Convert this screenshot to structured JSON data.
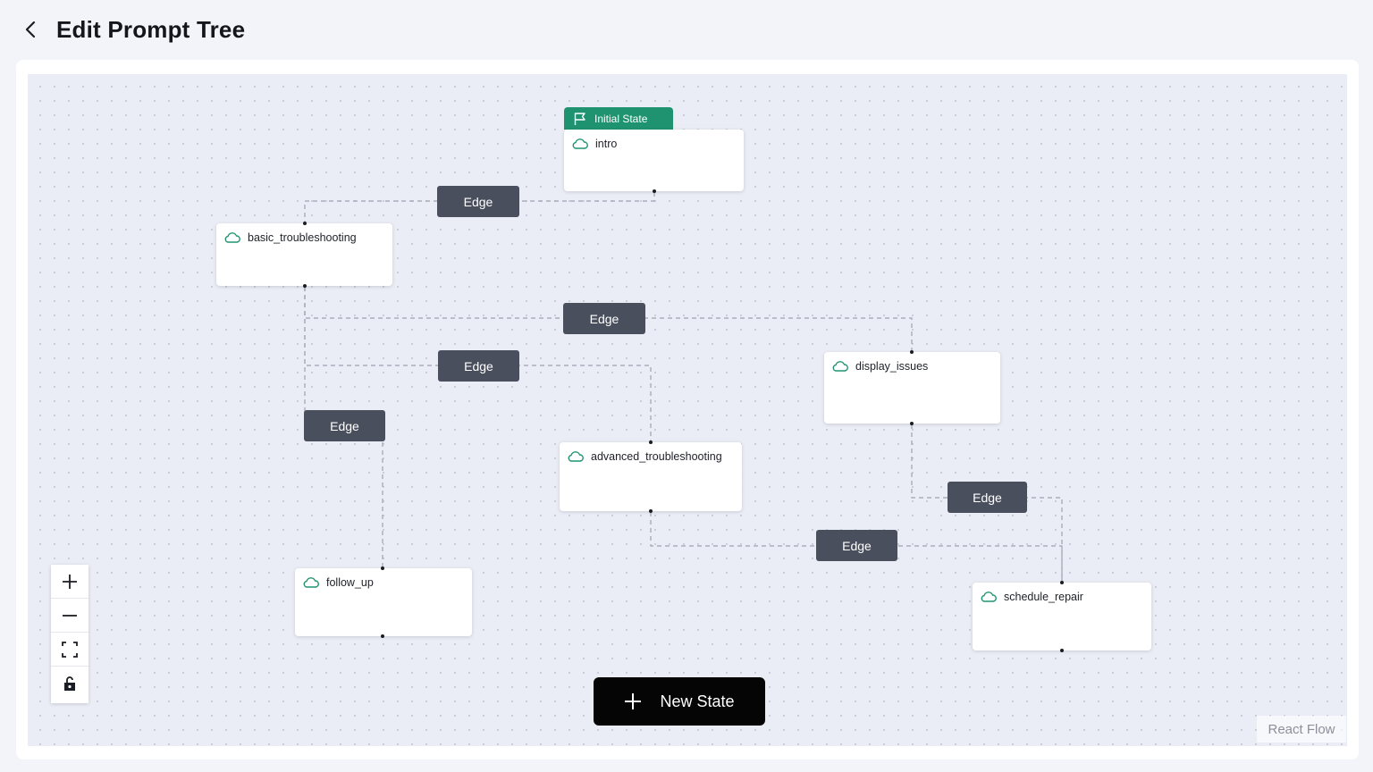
{
  "header": {
    "title": "Edit Prompt Tree"
  },
  "nodes": {
    "intro": {
      "label": "intro",
      "tag": "Initial State"
    },
    "basic_troubleshooting": {
      "label": "basic_troubleshooting"
    },
    "display_issues": {
      "label": "display_issues"
    },
    "advanced_troubleshooting": {
      "label": "advanced_troubleshooting"
    },
    "follow_up": {
      "label": "follow_up"
    },
    "schedule_repair": {
      "label": "schedule_repair"
    }
  },
  "edges": [
    {
      "label": "Edge"
    },
    {
      "label": "Edge"
    },
    {
      "label": "Edge"
    },
    {
      "label": "Edge"
    },
    {
      "label": "Edge"
    },
    {
      "label": "Edge"
    }
  ],
  "actions": {
    "new_state_label": "New State"
  },
  "attribution": "React Flow",
  "colors": {
    "initial_tag": "#1f9370",
    "edge_label": "#4a4f5d",
    "new_state_button": "#050505",
    "node_icon": "#1f9370"
  }
}
